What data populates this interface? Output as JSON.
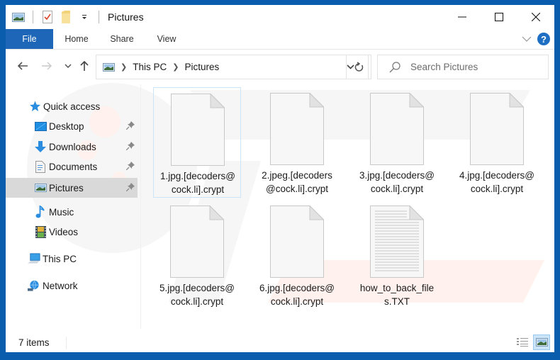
{
  "window": {
    "title": "Pictures",
    "controls": {
      "minimize": "minimize",
      "maximize": "maximize",
      "close": "close"
    }
  },
  "quick_access_toolbar": {
    "icons": [
      "pictures-folder-icon",
      "properties-icon",
      "new-folder-icon",
      "customize-dropdown-icon"
    ]
  },
  "ribbon": {
    "tabs": [
      {
        "label": "File",
        "active": true
      },
      {
        "label": "Home"
      },
      {
        "label": "Share"
      },
      {
        "label": "View"
      }
    ],
    "help_label": "?"
  },
  "navigation": {
    "back": "back",
    "forward": "forward",
    "recent": "recent-locations",
    "up": "up"
  },
  "address": {
    "crumbs": [
      "This PC",
      "Pictures"
    ]
  },
  "search": {
    "placeholder": "Search Pictures"
  },
  "sidebar": {
    "items": [
      {
        "label": "Quick access",
        "icon": "star-icon",
        "level": 0
      },
      {
        "label": "Desktop",
        "icon": "desktop-icon",
        "pinned": true,
        "level": 1
      },
      {
        "label": "Downloads",
        "icon": "download-icon",
        "pinned": true,
        "level": 1
      },
      {
        "label": "Documents",
        "icon": "documents-icon",
        "pinned": true,
        "level": 1
      },
      {
        "label": "Pictures",
        "icon": "pictures-icon",
        "pinned": true,
        "level": 1,
        "selected": true
      },
      {
        "label": "Music",
        "icon": "music-icon",
        "level": 1
      },
      {
        "label": "Videos",
        "icon": "videos-icon",
        "level": 1
      },
      {
        "label": "This PC",
        "icon": "computer-icon",
        "level": 0
      },
      {
        "label": "Network",
        "icon": "network-icon",
        "level": 0
      }
    ]
  },
  "files": [
    {
      "name": "1.jpg.[decoders@cock.li].crypt",
      "line1": "1.jpg.[decoders@",
      "line2": "cock.li].crypt",
      "type": "blank",
      "selected": true
    },
    {
      "name": "2.jpeg.[decoders@cock.li].crypt",
      "line1": "2.jpeg.[decoders",
      "line2": "@cock.li].crypt",
      "type": "blank"
    },
    {
      "name": "3.jpg.[decoders@cock.li].crypt",
      "line1": "3.jpg.[decoders@",
      "line2": "cock.li].crypt",
      "type": "blank"
    },
    {
      "name": "4.jpg.[decoders@cock.li].crypt",
      "line1": "4.jpg.[decoders@",
      "line2": "cock.li].crypt",
      "type": "blank"
    },
    {
      "name": "5.jpg.[decoders@cock.li].crypt",
      "line1": "5.jpg.[decoders@",
      "line2": "cock.li].crypt",
      "type": "blank"
    },
    {
      "name": "6.jpg.[decoders@cock.li].crypt",
      "line1": "6.jpg.[decoders@",
      "line2": "cock.li].crypt",
      "type": "blank"
    },
    {
      "name": "how_to_back_files.TXT",
      "line1": "how_to_back_file",
      "line2": "s.TXT",
      "type": "text"
    }
  ],
  "status": {
    "item_count": "7 items",
    "views": [
      "details-view",
      "large-icons-view"
    ],
    "active_view": "large-icons-view"
  },
  "colors": {
    "frame": "#0a5cad",
    "file_tab": "#1d66b8",
    "selection": "#cce4f7",
    "nav_selected": "#d9d9d9"
  }
}
